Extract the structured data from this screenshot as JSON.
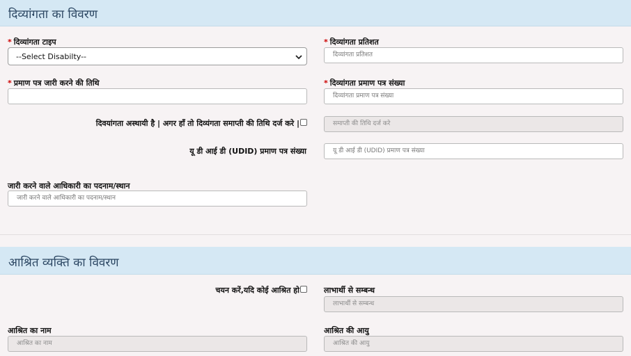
{
  "disability_section": {
    "title": "दिव्यांगता का विवरण",
    "disability_type_label": "दिव्यांगता टाइप",
    "disability_type_selected": "--Select Disabilty--",
    "disability_percent_label": "दिव्यांगता प्रतिशत",
    "disability_percent_placeholder": "दिव्यांगता प्रतिशत",
    "certificate_date_label": "प्रमाण पत्र जारी करने की तिथि",
    "certificate_date_value": "",
    "certificate_number_label": "दिव्यांगता प्रमाण  पत्र संख्या",
    "certificate_number_placeholder": "दिव्यांगता प्रमाण  पत्र संख्या",
    "temporary_label": "दिवयांगता अस्थायी है | अगर हाँ तो दिव्यंगता समाप्ती की तिथि दर्ज करे |",
    "temporary_checked": false,
    "end_date_placeholder": "समाप्ती की तिथि दर्ज करे",
    "udid_label": "यू डी आई डी (UDID) प्रमाण पत्र संख्या",
    "udid_placeholder": "यू डी आई डी (UDID) प्रमाण पत्र संख्या",
    "officer_label": "जारी करने वाले आधिकारी का पदनाम/स्थान",
    "officer_placeholder": "जारी करने वाले  आधिकारी का  पदनाम/स्थान"
  },
  "dependent_section": {
    "title": "आश्रित व्यक्ति का विवरण",
    "select_dependent_label": "चयन करें,यदि कोई आश्रित हो",
    "select_dependent_checked": false,
    "relation_label": "लाभार्थी से सम्बन्ध",
    "relation_placeholder": "लाभार्थी से सम्बन्ध",
    "name_label": "आश्रित का नाम",
    "name_placeholder": "आश्रित का नाम",
    "age_label": "आश्रित की आयु",
    "age_placeholder": "आश्रित की आयु"
  },
  "required_marker": "*",
  "colors": {
    "header_bg": "#d5e8f4",
    "header_text": "#2c4763",
    "required": "#cc0000",
    "page_bg": "#f7f3f4"
  },
  "icons": {
    "select_arrow": "chevron-down-icon"
  }
}
